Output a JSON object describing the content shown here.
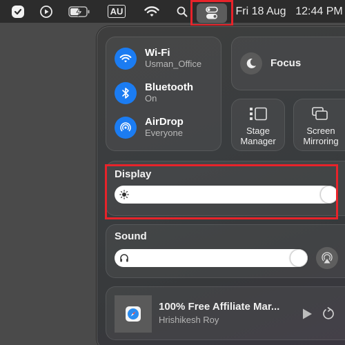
{
  "menubar": {
    "icons": [
      "checkmark-app-icon",
      "play-circle-icon",
      "battery-charging-icon",
      "input-source-icon",
      "wifi-icon",
      "search-icon",
      "control-center-icon"
    ],
    "input_source": "AU",
    "date": "Fri 18 Aug",
    "time": "12:44 PM"
  },
  "control_center": {
    "connectivity": [
      {
        "icon": "wifi-icon",
        "title": "Wi-Fi",
        "subtitle": "Usman_Office",
        "active": true
      },
      {
        "icon": "bluetooth-icon",
        "title": "Bluetooth",
        "subtitle": "On",
        "active": true
      },
      {
        "icon": "airdrop-icon",
        "title": "AirDrop",
        "subtitle": "Everyone",
        "active": true
      }
    ],
    "focus": {
      "label": "Focus"
    },
    "stage_manager": {
      "line1": "Stage",
      "line2": "Manager"
    },
    "screen_mirroring": {
      "line1": "Screen",
      "line2": "Mirroring"
    },
    "display": {
      "title": "Display",
      "brightness": 1.0
    },
    "sound": {
      "title": "Sound",
      "volume": 0.9
    },
    "now_playing": {
      "title": "100% Free Affiliate Mar...",
      "artist": "Hrishikesh Roy"
    }
  },
  "colors": {
    "accent": "#1b7cf2",
    "highlight": "#e8232a"
  }
}
